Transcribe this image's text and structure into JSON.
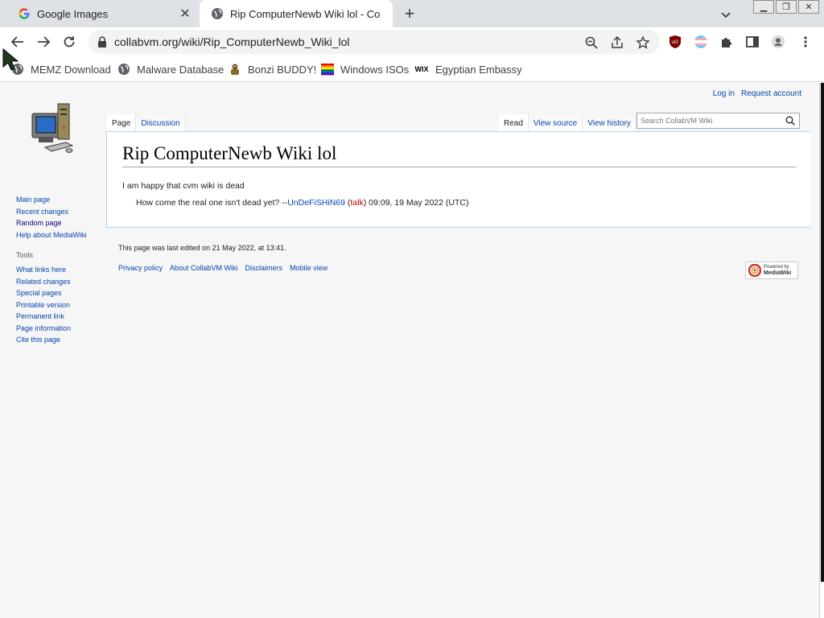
{
  "browser": {
    "tabs": [
      {
        "title": "Google Images",
        "favicon": "google-g-icon",
        "active": false
      },
      {
        "title": "Rip ComputerNewb Wiki lol - Co",
        "favicon": "globe-icon",
        "active": true
      }
    ],
    "url": "collabvm.org/wiki/Rip_ComputerNewb_Wiki_lol",
    "bookmarks": [
      {
        "label": "MEMZ Download",
        "icon": "globe-icon"
      },
      {
        "label": "Malware Database",
        "icon": "globe-icon"
      },
      {
        "label": "Bonzi BUDDY!",
        "icon": "bonzi-icon"
      },
      {
        "label": "Windows ISOs",
        "icon": "windows-flag-icon"
      },
      {
        "label": "Egyptian Embassy",
        "icon": "wix-icon"
      }
    ],
    "wix_icon_text": "WIX"
  },
  "wiki": {
    "personal": {
      "login": "Log in",
      "request": "Request account"
    },
    "navigation": [
      "Main page",
      "Recent changes",
      "Random page",
      "Help about MediaWiki"
    ],
    "tools_heading": "Tools",
    "tools": [
      "What links here",
      "Related changes",
      "Special pages",
      "Printable version",
      "Permanent link",
      "Page information",
      "Cite this page"
    ],
    "tabs_left": [
      "Page",
      "Discussion"
    ],
    "tabs_right": [
      "Read",
      "View source",
      "View history"
    ],
    "search_placeholder": "Search CollabVM Wiki",
    "title": "Rip ComputerNewb Wiki lol",
    "body": {
      "para1": "I am happy that cvm wiki is dead",
      "para2_text": "How come the real one isn't dead yet? --",
      "para2_user": "UnDeFiSHiN69",
      "para2_talk": "talk",
      "para2_time": "09:09, 19 May 2022 (UTC)"
    },
    "footer": {
      "last_edited": "This page was last edited on 21 May 2022, at 13:41.",
      "links": [
        "Privacy policy",
        "About CollabVM Wiki",
        "Disclaimers",
        "Mobile view"
      ],
      "powered_by": "Powered by",
      "powered_name": "MediaWiki"
    }
  }
}
